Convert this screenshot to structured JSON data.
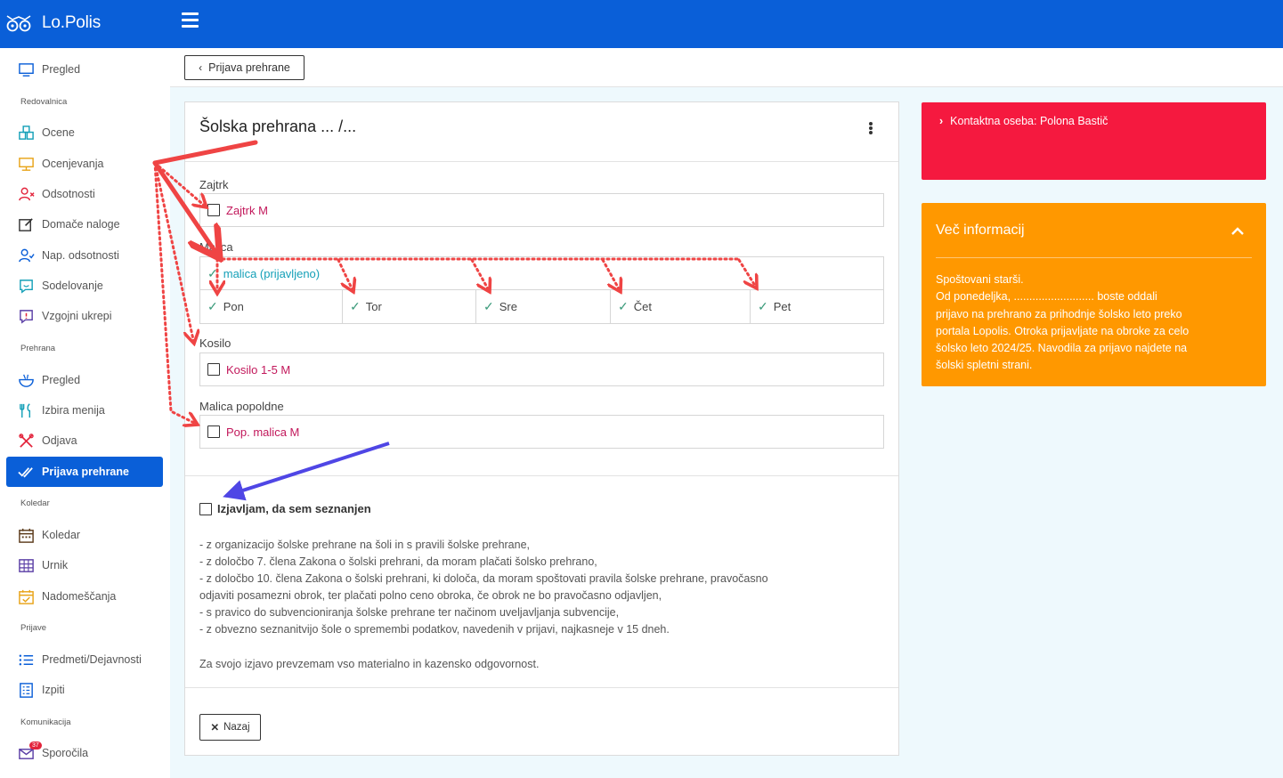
{
  "app": {
    "name": "Lo.Polis"
  },
  "sidebar": {
    "items": [
      {
        "label": "Pregled",
        "icon": "monitor-icon"
      },
      {
        "label": "Ocene",
        "icon": "blocks-icon"
      },
      {
        "label": "Ocenjevanja",
        "icon": "presentation-icon"
      },
      {
        "label": "Odsotnosti",
        "icon": "user-x-icon"
      },
      {
        "label": "Domače naloge",
        "icon": "edit-icon"
      },
      {
        "label": "Nap. odsotnosti",
        "icon": "user-check-icon"
      },
      {
        "label": "Sodelovanje",
        "icon": "chat-icon"
      },
      {
        "label": "Vzgojni ukrepi",
        "icon": "alert-chat-icon"
      },
      {
        "label": "Pregled",
        "icon": "bowl-icon"
      },
      {
        "label": "Izbira menija",
        "icon": "cutlery-icon"
      },
      {
        "label": "Odjava",
        "icon": "no-utensils-icon"
      },
      {
        "label": "Prijava prehrane",
        "icon": "double-check-icon"
      },
      {
        "label": "Koledar",
        "icon": "calendar-icon"
      },
      {
        "label": "Urnik",
        "icon": "grid-icon"
      },
      {
        "label": "Nadomeščanja",
        "icon": "calendar-check-icon"
      },
      {
        "label": "Predmeti/Dejavnosti",
        "icon": "list-icon"
      },
      {
        "label": "Izpiti",
        "icon": "checklist-icon"
      },
      {
        "label": "Sporočila",
        "icon": "mail-icon",
        "badge": "37"
      }
    ],
    "sections": [
      "Redovalnica",
      "Prehrana",
      "Koledar",
      "Prijave",
      "Komunikacija"
    ]
  },
  "breadcrumb": {
    "back_label": "Prijava prehrane"
  },
  "card": {
    "title": "Šolska prehrana ...  /...",
    "meals": [
      {
        "label": "Zajtrk",
        "option": "Zajtrk M",
        "checked": false
      },
      {
        "label": "Malica",
        "option": "malica (prijavljeno)",
        "checked": true
      },
      {
        "label": "Kosilo",
        "option": "Kosilo 1-5 M",
        "checked": false
      },
      {
        "label": "Malica popoldne",
        "option": "Pop. malica M",
        "checked": false
      }
    ],
    "days": [
      "Pon",
      "Tor",
      "Sre",
      "Čet",
      "Pet"
    ],
    "consent_label": "Izjavljam, da sem seznanjen",
    "declarations": [
      "- z organizacijo šolske prehrane na šoli in s pravili šolske prehrane,",
      "- z določbo 7. člena Zakona o šolski prehrani, da moram plačati šolsko prehrano,",
      "- z določbo 10. člena Zakona o šolski prehrani, ki določa, da moram spoštovati pravila šolske prehrane, pravočasno",
      "odjaviti posamezni obrok, ter plačati polno ceno obroka, če obrok ne bo pravočasno odjavljen,",
      "- s pravico do subvencioniranja šolske prehrane ter načinom uveljavljanja subvencije,",
      "- z obvezno seznanitvijo šole o spremembi podatkov, navedenih v prijavi, najkasneje v 15 dneh."
    ],
    "responsibility": "Za svojo izjavo prevzemam vso materialno in kazensko odgovornost.",
    "back_button": "Nazaj"
  },
  "contact": {
    "text": "Kontaktna oseba: Polona Bastič"
  },
  "info": {
    "title": "Več informacij",
    "body": [
      "Spoštovani starši.",
      "Od ponedeljka, .......................... boste oddali",
      "prijavo na prehrano za prihodnje šolsko leto preko",
      "portala Lopolis. Otroka prijavljate na obroke za celo",
      "šolsko leto 2024/25. Navodila za prijavo najdete na",
      "šolski spletni strani."
    ]
  },
  "colors": {
    "primary": "#0a5fd8",
    "contact_bg": "#f5193f",
    "info_bg": "#ff9800",
    "meal_text": "#c2185b",
    "registered_text": "#15a0b8",
    "annotation_red": "#ef4444",
    "annotation_blue": "#4f46e5"
  }
}
